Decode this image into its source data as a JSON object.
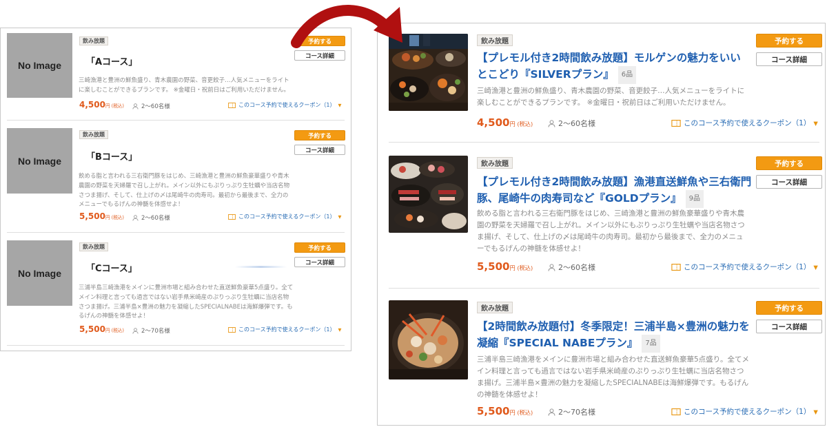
{
  "before": {
    "no_image_label": "No Image",
    "tag_label": "飲み放題",
    "reserve_label": "予約する",
    "detail_label": "コース詳細",
    "price_suffix": "円 (税込)",
    "coupon_label": "このコース予約で使えるクーポン（1）",
    "courses": [
      {
        "title": "「Aコース」",
        "desc": "三崎漁港と豊洲の鮮魚盛り、青木農園の野菜、音更餃子…人気メニューをライトに楽しむことができるプランです。 ※金曜日・祝前日はご利用いただけません。",
        "price": "4,500",
        "people": "2～60名様"
      },
      {
        "title": "「Bコース」",
        "desc": "飲める脂と言われる三右衛門豚をはじめ、三崎漁港と豊洲の鮮魚豪華盛りや青木農園の野菜を天婦羅で召し上がれ。メイン以外にもぷりっぷり生牡蠣や当店名物さつま揚げ、そして、仕上げの〆は尾崎牛の肉寿司。最初から最後まで、全力のメニューでもるげんの神髄を体感せよ！",
        "price": "5,500",
        "people": "2～60名様"
      },
      {
        "title": "「Cコース」",
        "desc": "三浦半島三崎漁港をメインに豊洲市場と組み合わせた直送鮮魚豪華5点盛り。全てメイン料理と言っても過言ではない岩手県米崎産のぷりっぷり生牡蠣に当店名物さつま揚げ。三浦半島×豊洲の魅力を凝縮したSPECIALNABEは海鮮爆弾です。もるげんの神髄を体感せよ！",
        "price": "5,500",
        "people": "2～70名様"
      }
    ]
  },
  "after": {
    "tag_label": "飲み放題",
    "reserve_label": "予約する",
    "detail_label": "コース詳細",
    "price_suffix": "円 (税込)",
    "coupon_label": "このコース予約で使えるクーポン（1）",
    "courses": [
      {
        "title": "【プレモル付き2時間飲み放題】モルゲンの魅力をいいとこどり『SILVERプラン』",
        "count": "6品",
        "desc": "三崎漁港と豊洲の鮮魚盛り、青木農園の野菜、音更餃子…人気メニューをライトに楽しむことができるプランです。 ※金曜日・祝前日はご利用いただけません。",
        "price": "4,500",
        "people": "2～60名様"
      },
      {
        "title": "【プレモル付き2時間飲み放題】漁港直送鮮魚や三右衛門豚、尾崎牛の肉寿司など『GOLDプラン』",
        "count": "9品",
        "desc": "飲める脂と言われる三右衛門豚をはじめ、三崎漁港と豊洲の鮮魚豪華盛りや青木農園の野菜を天婦羅で召し上がれ。メイン以外にもぷりっぷり生牡蠣や当店名物さつま揚げ、そして、仕上げの〆は尾崎牛の肉寿司。最初から最後まで、全力のメニューでもるげんの神髄を体感せよ！",
        "price": "5,500",
        "people": "2～60名様"
      },
      {
        "title": "【2時間飲み放題付】冬季限定！三浦半島×豊洲の魅力を凝縮『SPECIAL NABEプラン』",
        "count": "7品",
        "desc": "三浦半島三崎漁港をメインに豊洲市場と組み合わせた直送鮮魚豪華5点盛り。全てメイン料理と言っても過言ではない岩手県米崎産のぷりっぷり生牡蠣に当店名物さつま揚げ。三浦半島×豊洲の魅力を凝縮したSPECIALNABEは海鮮爆弾です。もるげんの神髄を体感せよ！",
        "price": "5,500",
        "people": "2～70名様"
      }
    ]
  },
  "colors": {
    "accent_orange": "#f39a12",
    "price_red": "#e05a1c",
    "link_blue": "#1f5fb0",
    "arrow_red": "#b01010"
  }
}
